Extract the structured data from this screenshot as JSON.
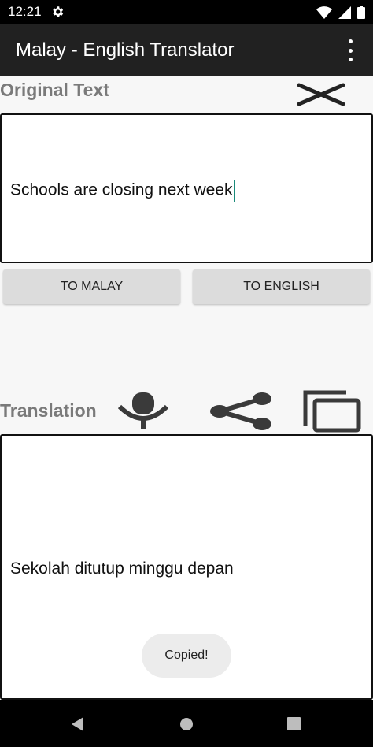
{
  "status_bar": {
    "time": "12:21"
  },
  "app_bar": {
    "title": "Malay - English Translator"
  },
  "original": {
    "label": "Original Text",
    "text": "Schools are closing next week"
  },
  "buttons": {
    "to_malay": "TO MALAY",
    "to_english": "TO ENGLISH"
  },
  "translation": {
    "label": "Translation",
    "text": "Sekolah ditutup minggu depan"
  },
  "toast": {
    "text": "Copied!"
  },
  "colors": {
    "app_bar": "#212121",
    "status_bar": "#000000",
    "label": "#7a7a7a",
    "cursor": "#1a8a7a",
    "button": "#dcdcdc"
  }
}
